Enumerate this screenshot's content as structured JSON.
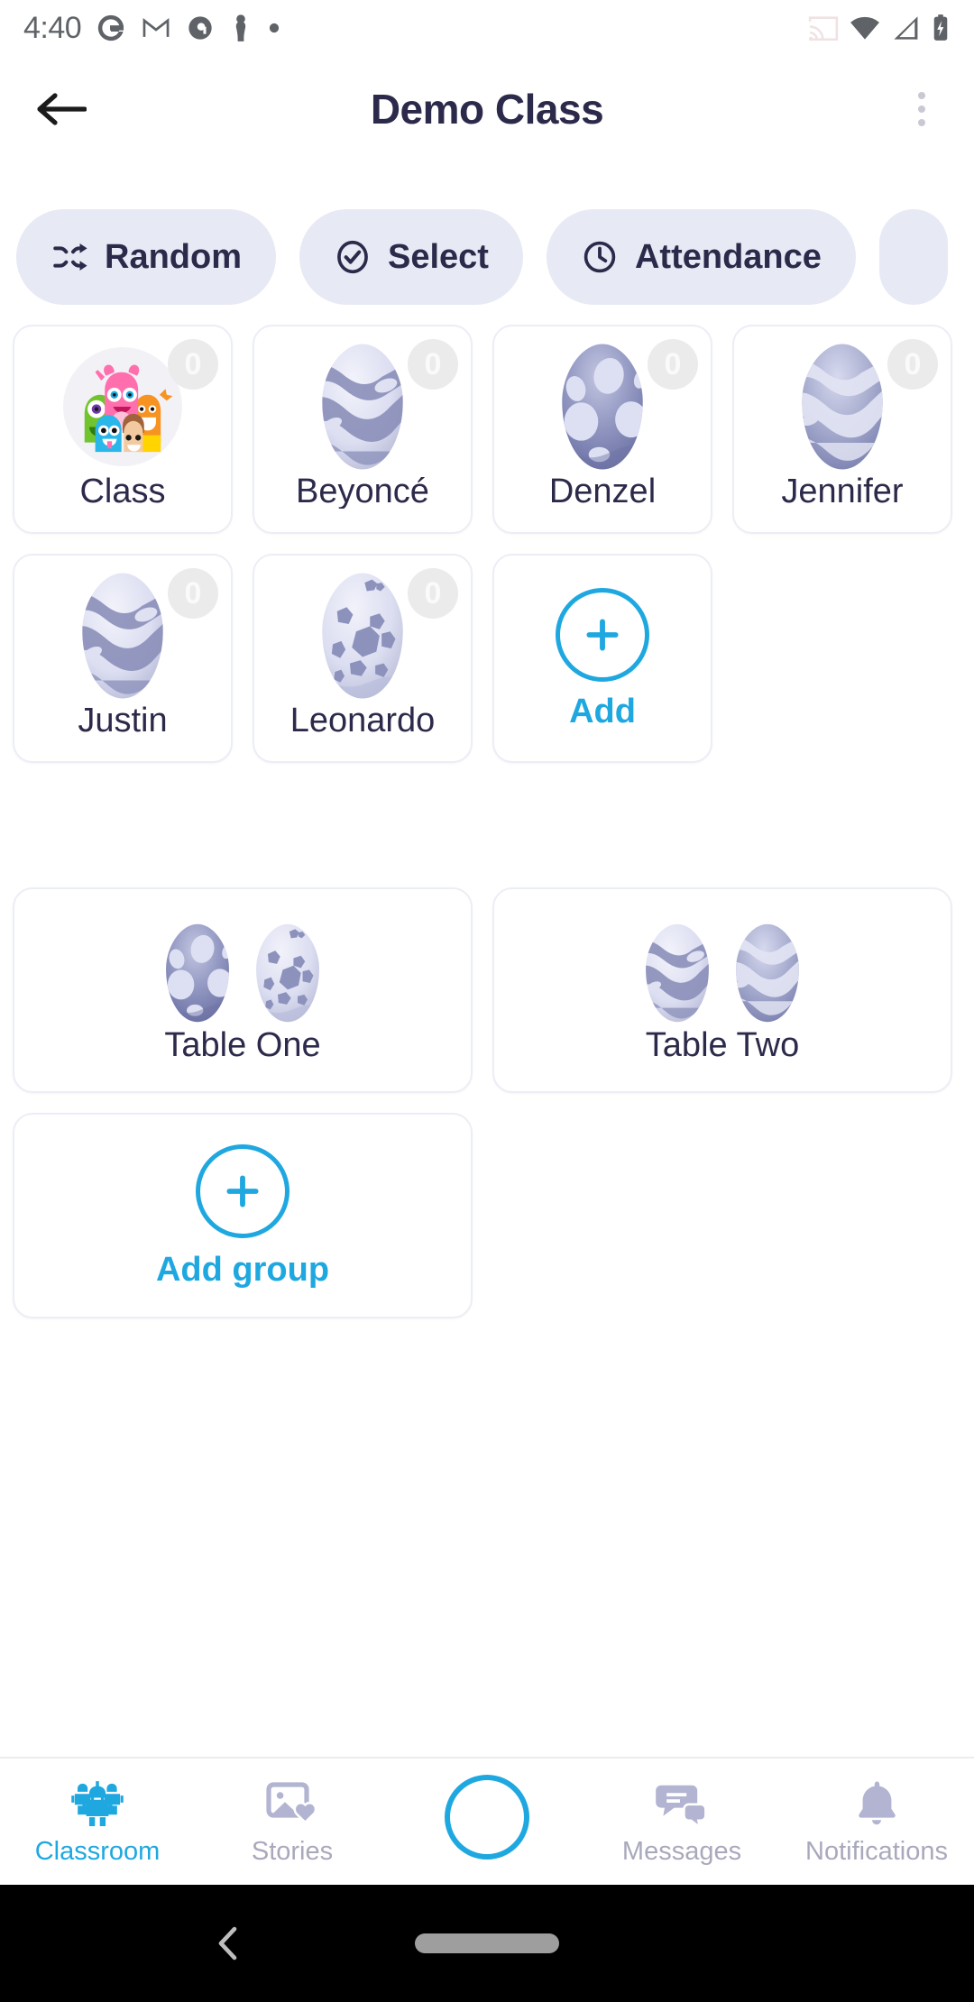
{
  "status_bar": {
    "time": "4:40",
    "left_icons": [
      "google-icon",
      "gmail-icon",
      "podcast-icon",
      "chess-pawn-icon",
      "dot-icon"
    ],
    "right_icons": [
      "cast-icon",
      "wifi-icon",
      "signal-icon",
      "battery-charging-icon"
    ]
  },
  "app_bar": {
    "back_icon": "back-arrow-icon",
    "title": "Demo Class",
    "overflow_icon": "kebab-menu-icon"
  },
  "chips": [
    {
      "label": "Random",
      "icon": "shuffle-icon"
    },
    {
      "label": "Select",
      "icon": "check-circle-icon"
    },
    {
      "label": "Attendance",
      "icon": "clock-icon"
    },
    {
      "label": "",
      "icon": "partial-chip"
    }
  ],
  "students": [
    {
      "name": "Class",
      "points": "0",
      "avatar": "class-monsters-avatar"
    },
    {
      "name": "Beyoncé",
      "points": "0",
      "avatar": "egg-wave-light"
    },
    {
      "name": "Denzel",
      "points": "0",
      "avatar": "egg-spots-dark"
    },
    {
      "name": "Jennifer",
      "points": "0",
      "avatar": "egg-wave-mid"
    },
    {
      "name": "Justin",
      "points": "0",
      "avatar": "egg-wave-light"
    },
    {
      "name": "Leonardo",
      "points": "0",
      "avatar": "egg-polygon-light"
    }
  ],
  "add_student": {
    "label": "Add",
    "icon": "plus-circle-icon"
  },
  "groups": [
    {
      "name": "Table One",
      "eggs": [
        "egg-spots-dark",
        "egg-polygon-light"
      ]
    },
    {
      "name": "Table Two",
      "eggs": [
        "egg-wave-light",
        "egg-wave-dark"
      ]
    }
  ],
  "add_group": {
    "label": "Add group",
    "icon": "plus-circle-icon"
  },
  "bottom_nav": [
    {
      "label": "Classroom",
      "icon": "classroom-kids-icon",
      "active": true
    },
    {
      "label": "Stories",
      "icon": "photo-heart-icon",
      "active": false
    },
    {
      "label": "",
      "icon": "camera-circle-icon",
      "active": false
    },
    {
      "label": "Messages",
      "icon": "chat-bubbles-icon",
      "active": false
    },
    {
      "label": "Notifications",
      "icon": "bell-icon",
      "active": false
    }
  ],
  "android_nav": {
    "back_icon": "chevron-back-icon",
    "home_pill": "home-pill"
  },
  "colors": {
    "accent": "#1fa8e0",
    "title": "#2c2a4a",
    "chip_bg": "#e7eaf4",
    "badge_bg": "#ebebeb",
    "muted": "#a9a9bd",
    "card_border": "#eceef6"
  }
}
